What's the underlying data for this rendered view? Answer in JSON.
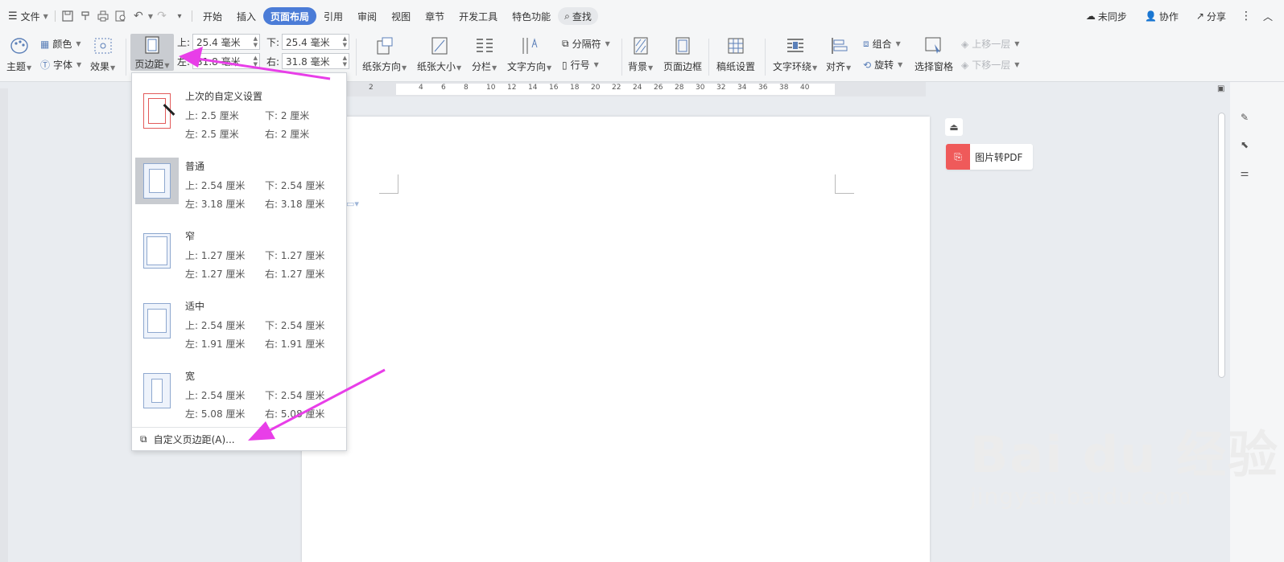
{
  "menubar": {
    "file": "文件",
    "tabs": [
      "开始",
      "插入",
      "页面布局",
      "引用",
      "审阅",
      "视图",
      "章节",
      "开发工具",
      "特色功能"
    ],
    "active_tab": "页面布局",
    "search": "查找",
    "sync": "未同步",
    "collab": "协作",
    "share": "分享"
  },
  "ribbon": {
    "theme": "主题",
    "color": "颜色",
    "font": "字体",
    "effect": "效果",
    "margin_btn": "页边距",
    "margin_top_label": "上:",
    "margin_top_value": "25.4 毫米",
    "margin_bottom_label": "下:",
    "margin_bottom_value": "25.4 毫米",
    "margin_left_label": "左:",
    "margin_left_value": "31.8 毫米",
    "margin_right_label": "右:",
    "margin_right_value": "31.8 毫米",
    "orientation": "纸张方向",
    "size": "纸张大小",
    "columns": "分栏",
    "text_direction": "文字方向",
    "breaks": "分隔符",
    "line_numbers": "行号",
    "background": "背景",
    "page_border": "页面边框",
    "draft_paper": "稿纸设置",
    "wrap_text": "文字环绕",
    "align": "对齐",
    "group": "组合",
    "rotate": "旋转",
    "selection_pane": "选择窗格",
    "bring_forward": "上移一层",
    "send_backward": "下移一层"
  },
  "ruler": {
    "numbers": [
      "2",
      "2",
      "4",
      "6",
      "8",
      "10",
      "12",
      "14",
      "16",
      "18",
      "20",
      "22",
      "24",
      "26",
      "28",
      "30",
      "32",
      "34",
      "36",
      "38",
      "40"
    ]
  },
  "dropdown": {
    "presets": [
      {
        "name": "上次的自定义设置",
        "top": "上: 2.5 厘米",
        "bottom": "下: 2 厘米",
        "left": "左: 2.5 厘米",
        "right": "右: 2 厘米"
      },
      {
        "name": "普通",
        "top": "上: 2.54 厘米",
        "bottom": "下: 2.54 厘米",
        "left": "左: 3.18 厘米",
        "right": "右: 3.18 厘米"
      },
      {
        "name": "窄",
        "top": "上: 1.27 厘米",
        "bottom": "下: 1.27 厘米",
        "left": "左: 1.27 厘米",
        "right": "右: 1.27 厘米"
      },
      {
        "name": "适中",
        "top": "上: 2.54 厘米",
        "bottom": "下: 2.54 厘米",
        "left": "左: 1.91 厘米",
        "right": "右: 1.91 厘米"
      },
      {
        "name": "宽",
        "top": "上: 2.54 厘米",
        "bottom": "下: 2.54 厘米",
        "left": "左: 5.08 厘米",
        "right": "右: 5.08 厘米"
      }
    ],
    "custom": "自定义页边距(A)..."
  },
  "side": {
    "pdf_button": "图片转PDF"
  },
  "watermark": {
    "brand": "Bai du 经验",
    "url": "jingyan.baidu.com"
  },
  "colors": {
    "active_tab": "#4b7cd7",
    "arrow": "#e83ee8",
    "pdf_red": "#ef5a5a"
  }
}
